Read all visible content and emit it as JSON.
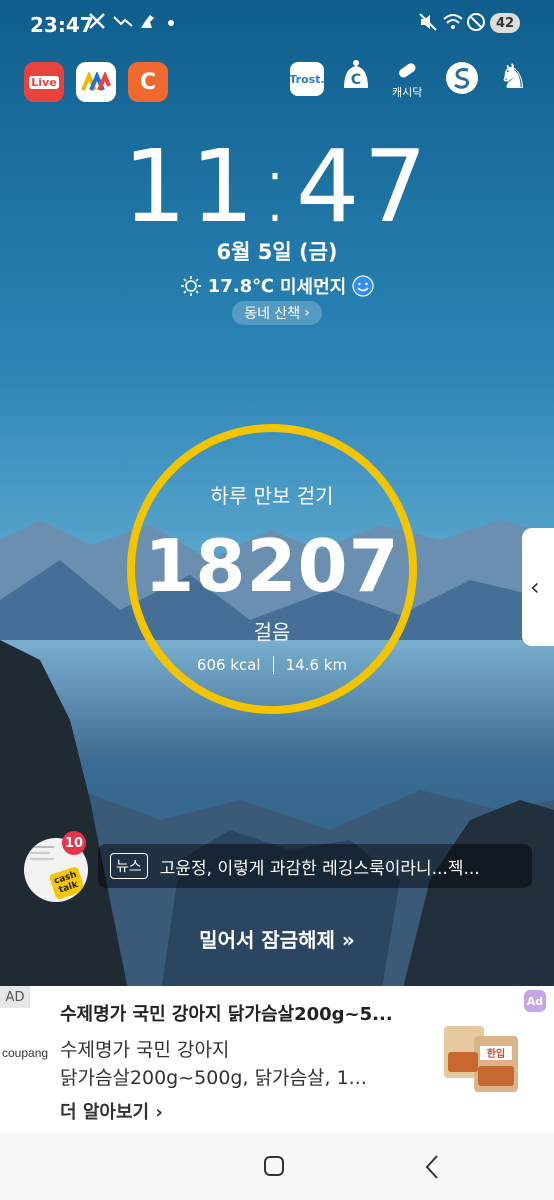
{
  "status_bar": {
    "time": "23:47",
    "notif_icons": [
      "x-icon",
      "missed-call-icon",
      "bird-icon",
      "dot-icon"
    ],
    "system_icons": [
      "mute-icon",
      "wifi-icon",
      "blocked-icon"
    ],
    "battery": "42"
  },
  "apps_left": [
    {
      "name": "live-app",
      "label": "Live",
      "color": "#e8423c"
    },
    {
      "name": "m-app",
      "label": "M",
      "color": "#ffffff"
    },
    {
      "name": "cashwalk-app",
      "label": "C",
      "color": "#f06a2f"
    }
  ],
  "apps_right": [
    {
      "name": "trost-app",
      "label": "Trost."
    },
    {
      "name": "c-app",
      "label": "C"
    },
    {
      "name": "cashidak-app",
      "label": "캐시닥"
    },
    {
      "name": "s-app",
      "label": "S"
    },
    {
      "name": "chess-app",
      "label": "♞"
    }
  ],
  "clock": {
    "hours": "11",
    "minutes": "47"
  },
  "date": "6월 5일 (금)",
  "weather": {
    "temp": "17.8℃",
    "dust": "미세먼지"
  },
  "walk_button": "동네 산책",
  "steps": {
    "title": "하루 만보 걷기",
    "count": "18207",
    "unit": "걸음",
    "kcal": "606 kcal",
    "distance": "14.6 km",
    "ring_color": "#f3c500"
  },
  "cashtalk": {
    "badge": "10",
    "label": "cash talk"
  },
  "news": {
    "tag": "뉴스",
    "headline": "고윤정, 이렇게 과감한 레깅스룩이라니...젝..."
  },
  "unlock_text": "밀어서 잠금해제",
  "ad": {
    "label": "AD",
    "title": "수제명가 국민 강아지 닭가슴살200g~5...",
    "brand": "coupang",
    "desc_line1": "수제명가 국민 강아지",
    "desc_line2": "닭가슴살200g~500g, 닭가슴살, 1...",
    "more": "더 알아보기",
    "more_chevron": "›",
    "product_text": "한입",
    "choice_label": "Ad"
  }
}
